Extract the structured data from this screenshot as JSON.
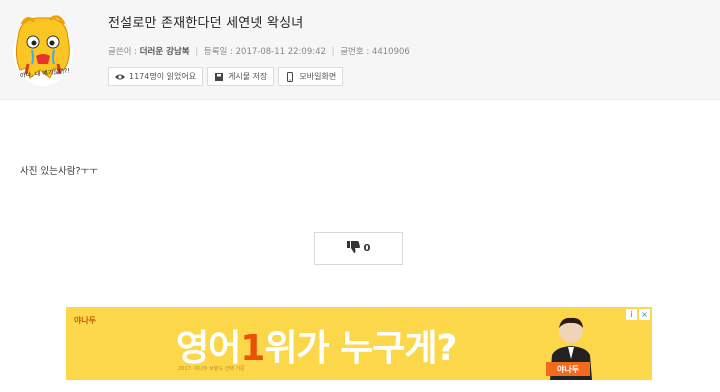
{
  "post": {
    "title": "전설로만 존재한다던 세연넷 왁싱녀",
    "avatar_caption": "아냐, 내 얘기잖아?!",
    "meta": {
      "author_label": "글쓴이 :",
      "author": "더러운 강남복",
      "date_label": "등록일 :",
      "date": "2017-08-11 22:09:42",
      "id_label": "글번호 :",
      "id": "4410906"
    },
    "actions": [
      {
        "label": "1174명이 읽었어요",
        "icon": "eye-icon"
      },
      {
        "label": "게시물 저장",
        "icon": "save-icon"
      },
      {
        "label": "모바일화면",
        "icon": "mobile-icon"
      }
    ],
    "body_text": "사진 있는사람?ㅜㅜ",
    "dislike_count": "0"
  },
  "ad": {
    "logo": "야나두",
    "headline_pre": "영어",
    "headline_num": "1",
    "headline_post": "위가 누구게?",
    "fine_print": "2017. 야나두 브랜드 선택 기준",
    "badge": "야나두",
    "info_glyph": "i",
    "close_glyph": "×"
  },
  "colors": {
    "header_bg": "#f6f6f6",
    "ad_bg": "#fcd74a",
    "ad_accent": "#e85200"
  }
}
